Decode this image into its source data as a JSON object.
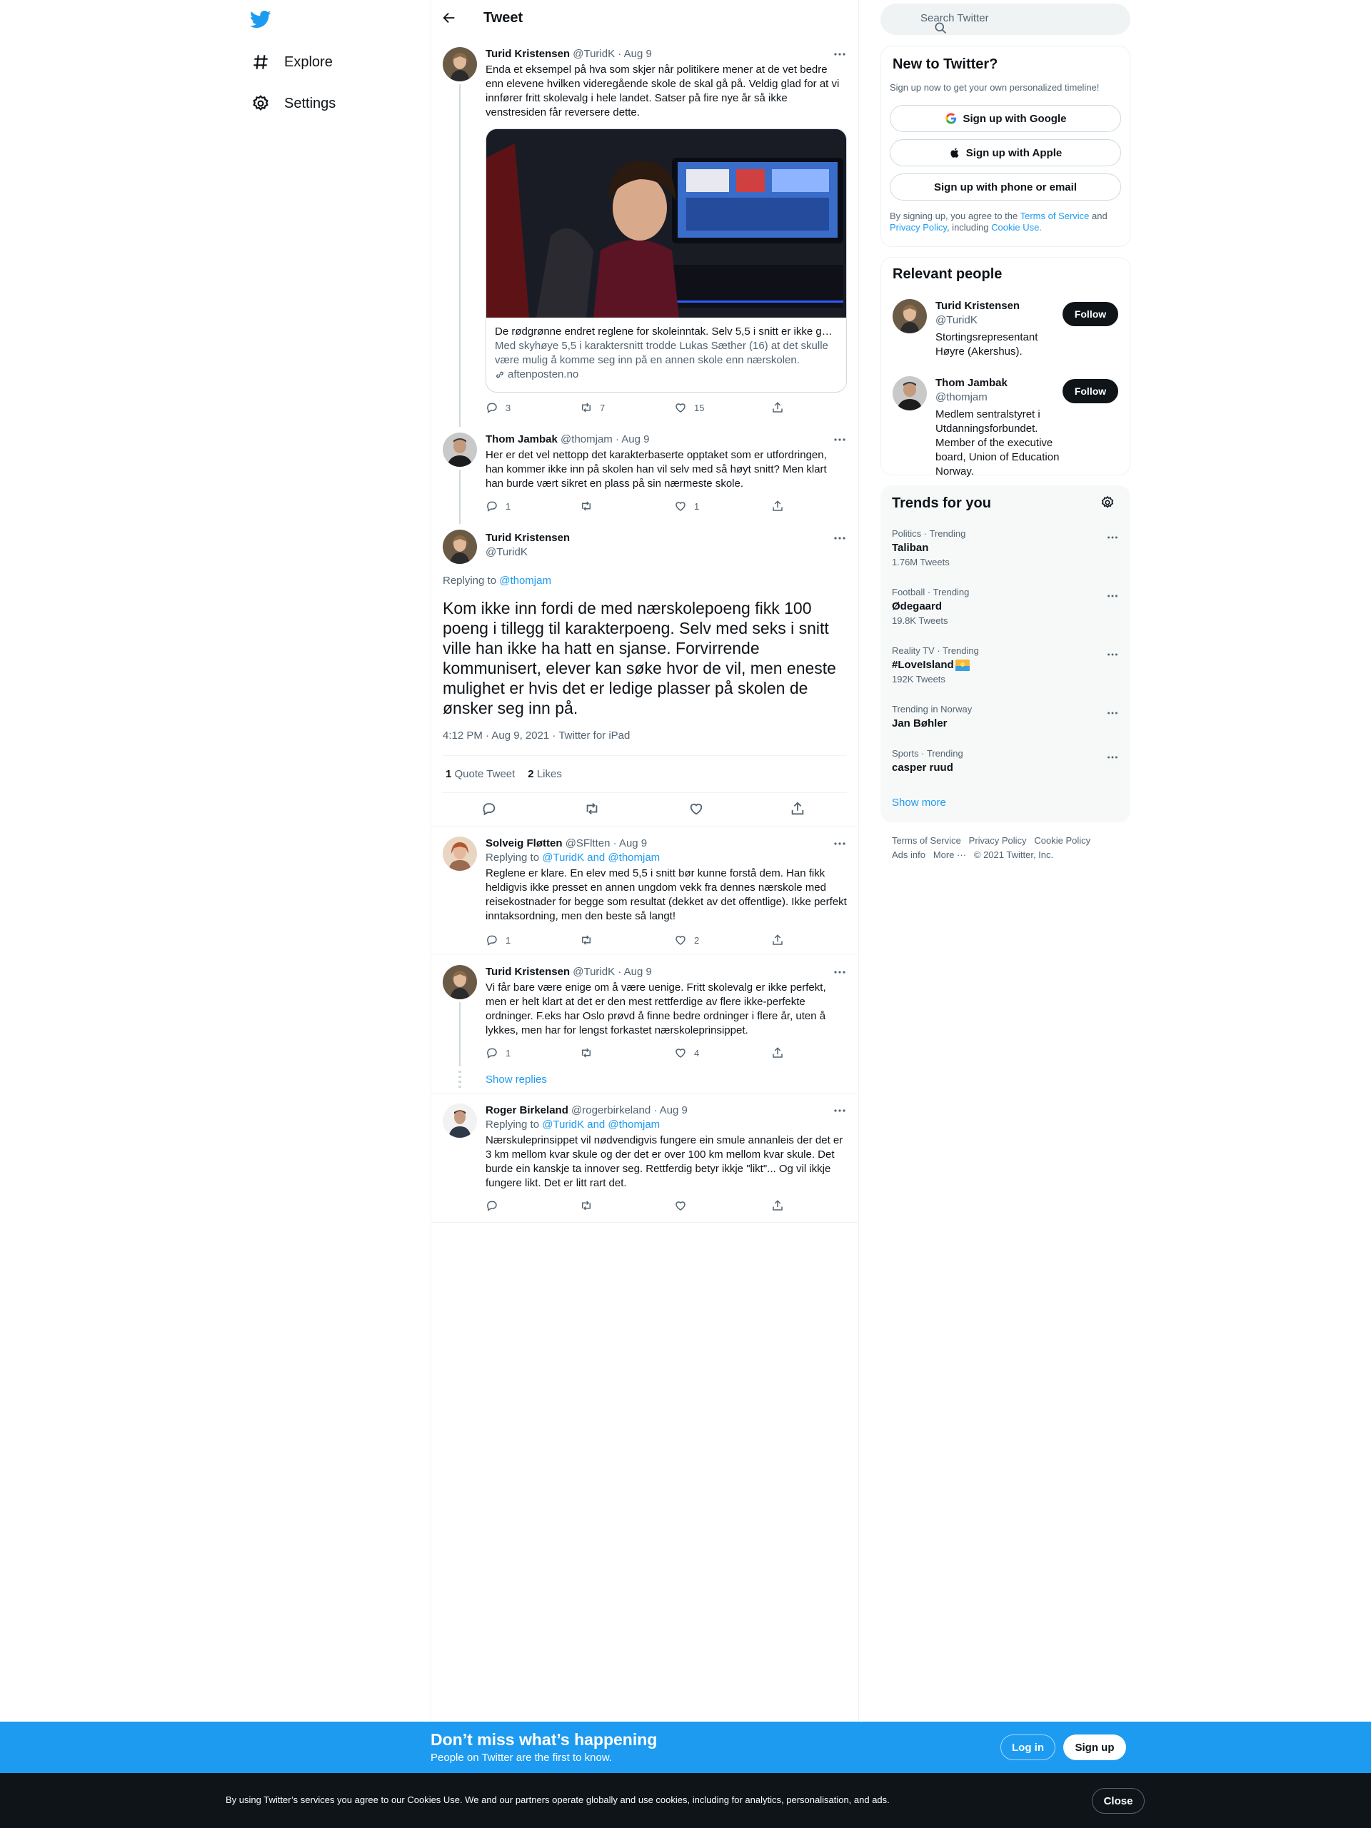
{
  "nav": {
    "items": [
      {
        "label": "Explore",
        "icon": "hashtag-icon"
      },
      {
        "label": "Settings",
        "icon": "gear-icon"
      }
    ]
  },
  "header": {
    "title": "Tweet"
  },
  "tweets": {
    "t1": {
      "name": "Turid Kristensen",
      "meta": "@TuridK · Aug 9",
      "text": "Enda et eksempel på hva som skjer når politikere mener at de vet bedre enn elevene hvilken videregående skole de skal gå på. Veldig glad for at vi innfører fritt skolevalg i hele landet. Satser på fire nye år så ikke venstresiden får reversere dette.",
      "card": {
        "title": "De rødgrønne endret reglene for skoleinntak. Selv 5,5 i snitt er ikke go…",
        "desc": "Med skyhøye 5,5 i karaktersnitt trodde Lukas Sæther (16) at det skulle være mulig å komme seg inn på en annen skole enn nærskolen.",
        "domain": "aftenposten.no"
      },
      "replies": "3",
      "retweets": "7",
      "likes": "15"
    },
    "t2": {
      "name": "Thom Jambak",
      "meta": "@thomjam · Aug 9",
      "text": "Her er det vel nettopp det karakterbaserte opptaket som er utfordringen, han kommer ikke inn på skolen han vil selv med så høyt snitt? Men klart han burde vært sikret en plass på sin nærmeste skole.",
      "replies": "1",
      "retweets": "",
      "likes": "1"
    },
    "main": {
      "name": "Turid Kristensen",
      "handle": "@TuridK",
      "replying_prefix": "Replying to ",
      "replying_to": "@thomjam",
      "text": "Kom ikke inn fordi de med nærskolepoeng fikk 100 poeng i tillegg til karakterpoeng. Selv med seks i snitt ville han ikke ha hatt en sjanse. Forvirrende kommunisert, elever kan søke hvor de vil, men eneste mulighet er hvis det er ledige plasser på skolen de ønsker seg inn på.",
      "timestamp": "4:12 PM · Aug 9, 2021 · Twitter for iPad",
      "quote_count": "1",
      "quote_label": "Quote Tweet",
      "likes_count": "2",
      "likes_label": "Likes"
    },
    "r1": {
      "name": "Solveig Fløtten",
      "meta": "@SFltten · Aug 9",
      "replying_prefix": "Replying to ",
      "replying_to": "@TuridK and @thomjam",
      "text": "Reglene er klare. En elev med 5,5 i snitt bør kunne forstå dem. Han fikk heldigvis ikke presset en annen ungdom vekk fra dennes nærskole med reisekostnader for begge som resultat (dekket av det offentlige). Ikke perfekt inntaksordning, men den beste så langt!",
      "replies": "1",
      "retweets": "",
      "likes": "2"
    },
    "r2": {
      "name": "Turid Kristensen",
      "meta": "@TuridK · Aug 9",
      "text": "Vi får bare være enige om å være uenige. Fritt skolevalg er ikke perfekt, men er helt klart at det er den mest rettferdige av flere ikke-perfekte ordninger. F.eks har Oslo prøvd å finne bedre ordninger i flere år, uten å lykkes, men har for lengst forkastet nærskoleprinsippet.",
      "replies": "1",
      "retweets": "",
      "likes": "4",
      "show_replies": "Show replies"
    },
    "r3": {
      "name": "Roger Birkeland",
      "meta": "@rogerbirkeland · Aug 9",
      "replying_prefix": "Replying to ",
      "replying_to": "@TuridK and @thomjam",
      "text": "Nærskuleprinsippet vil nødvendigvis fungere ein smule annanleis der det er 3 km mellom kvar skule og der det er over 100 km mellom kvar skule. Det burde ein kanskje ta innover seg. Rettferdig betyr ikkje \"likt\"... Og vil ikkje fungere likt. Det er litt rart det.",
      "replies": "",
      "retweets": "",
      "likes": ""
    }
  },
  "search": {
    "placeholder": "Search Twitter"
  },
  "new_to_twitter": {
    "title": "New to Twitter?",
    "subtitle": "Sign up now to get your own personalized timeline!",
    "google": "Sign up with Google",
    "apple": "Sign up with Apple",
    "phone": "Sign up with phone or email",
    "legal_1": "By signing up, you agree to the ",
    "terms": "Terms of Service",
    "legal_2": " and ",
    "privacy": "Privacy Policy",
    "legal_3": ", including ",
    "cookie": "Cookie Use."
  },
  "relevant": {
    "title": "Relevant people",
    "people": [
      {
        "name": "Turid Kristensen",
        "handle": "@TuridK",
        "bio": "Stortingsrepresentant Høyre (Akershus).",
        "button": "Follow"
      },
      {
        "name": "Thom Jambak",
        "handle": "@thomjam",
        "bio": "Medlem sentralstyret i Utdanningsforbundet. Member of the executive board, Union of Education Norway.",
        "button": "Follow"
      }
    ]
  },
  "trends": {
    "title": "Trends for you",
    "items": [
      {
        "category": "Politics · Trending",
        "name": "Taliban",
        "count": "1.76M Tweets"
      },
      {
        "category": "Football · Trending",
        "name": "Ødegaard",
        "count": "19.8K Tweets"
      },
      {
        "category": "Reality TV · Trending",
        "name": "#LoveIsland",
        "count": "192K Tweets"
      },
      {
        "category": "Trending in Norway",
        "name": "Jan Bøhler",
        "count": ""
      },
      {
        "category": "Sports · Trending",
        "name": "casper ruud",
        "count": ""
      }
    ],
    "show_more": "Show more"
  },
  "footer": {
    "terms": "Terms of Service",
    "privacy": "Privacy Policy",
    "cookie": "Cookie Policy",
    "ads": "Ads info",
    "more": "More ···",
    "copyright": "© 2021 Twitter, Inc."
  },
  "banner": {
    "title": "Don’t miss what’s happening",
    "subtitle": "People on Twitter are the first to know.",
    "login": "Log in",
    "signup": "Sign up"
  },
  "cookie_bar": {
    "text": "By using Twitter’s services you agree to our Cookies Use. We and our partners operate globally and use cookies, including for analytics, personalisation, and ads.",
    "close": "Close"
  },
  "colors": {
    "accent": "#1d9bf0",
    "text": "#0f1419",
    "muted": "#536471"
  }
}
